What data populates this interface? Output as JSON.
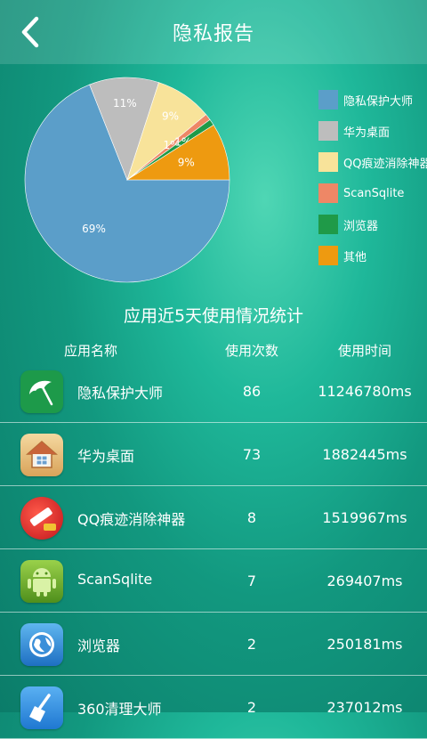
{
  "header": {
    "title": "隐私报告"
  },
  "chart_data": {
    "type": "pie",
    "slices": [
      {
        "name": "隐私保护大师",
        "value": 69,
        "label": "69%",
        "color": "#5b9ec9"
      },
      {
        "name": "华为桌面",
        "value": 11,
        "label": "11%",
        "color": "#bdbdbd"
      },
      {
        "name": "QQ痕迹消除神器",
        "value": 9,
        "label": "9%",
        "color": "#f8e39a"
      },
      {
        "name": "ScanSqlite",
        "value": 1,
        "label": "1%",
        "color": "#ee8766"
      },
      {
        "name": "浏览器",
        "value": 1,
        "label": "1%",
        "color": "#1f9a48"
      },
      {
        "name": "其他",
        "value": 9,
        "label": "9%",
        "color": "#ee9a10"
      }
    ],
    "legend_position": "right"
  },
  "stats": {
    "title": "应用近5天使用情况统计",
    "columns": [
      "应用名称",
      "使用次数",
      "使用时间"
    ],
    "rows": [
      {
        "name": "隐私保护大师",
        "count": "86",
        "time": "11246780ms",
        "icon": "umbrella-icon"
      },
      {
        "name": "华为桌面",
        "count": "73",
        "time": "1882445ms",
        "icon": "house-icon"
      },
      {
        "name": "QQ痕迹消除神器",
        "count": "8",
        "time": "1519967ms",
        "icon": "eraser-icon"
      },
      {
        "name": "ScanSqlite",
        "count": "7",
        "time": "269407ms",
        "icon": "android-icon"
      },
      {
        "name": "浏览器",
        "count": "2",
        "time": "250181ms",
        "icon": "globe-icon"
      },
      {
        "name": "360清理大师",
        "count": "2",
        "time": "237012ms",
        "icon": "broom-icon"
      }
    ]
  }
}
